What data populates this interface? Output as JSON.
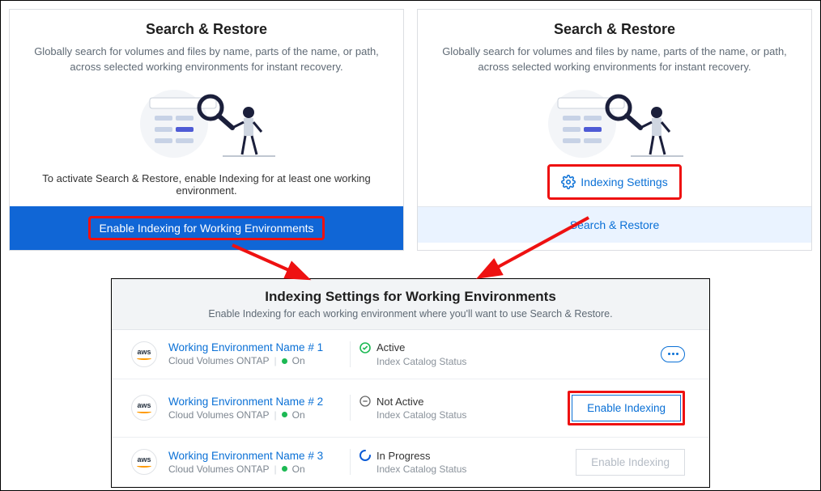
{
  "cardLeft": {
    "title": "Search & Restore",
    "desc": "Globally search for volumes and files by name, parts of the name, or path, across selected working environments for instant recovery.",
    "activateText": "To activate Search & Restore, enable Indexing for at least one working environment.",
    "buttonLabel": "Enable Indexing for Working Environments"
  },
  "cardRight": {
    "title": "Search & Restore",
    "desc": "Globally search for volumes and files by name, parts of the name, or path, across selected working environments for instant recovery.",
    "indexingSettingsLabel": "Indexing Settings",
    "searchRestoreLabel": "Search & Restore"
  },
  "panel": {
    "title": "Indexing Settings for Working Environments",
    "subtitle": "Enable Indexing for each working environment where you'll want to use Search & Restore.",
    "catalogLabel": "Index Catalog Status",
    "platformLabel": "Cloud Volumes ONTAP",
    "onLabel": "On",
    "enableLabel": "Enable Indexing",
    "providerLabel": "aws",
    "rows": [
      {
        "name": "Working Environment Name # 1",
        "status": "Active"
      },
      {
        "name": "Working Environment Name # 2",
        "status": "Not Active"
      },
      {
        "name": "Working Environment Name # 3",
        "status": "In Progress"
      }
    ]
  }
}
